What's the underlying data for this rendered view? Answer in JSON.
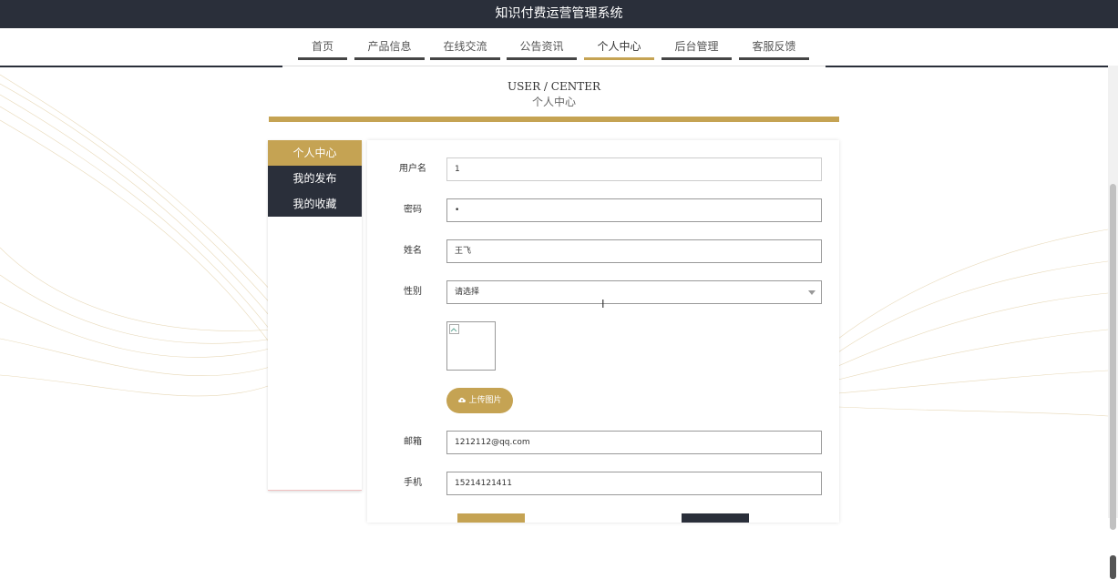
{
  "app": {
    "title": "知识付费运营管理系统"
  },
  "nav": {
    "items": [
      {
        "label": "首页"
      },
      {
        "label": "产品信息"
      },
      {
        "label": "在线交流"
      },
      {
        "label": "公告资讯"
      },
      {
        "label": "个人中心"
      },
      {
        "label": "后台管理"
      },
      {
        "label": "客服反馈"
      }
    ],
    "active": "个人中心"
  },
  "heading": {
    "en": "USER / CENTER",
    "cn": "个人中心"
  },
  "sidebar": {
    "items": [
      {
        "label": "个人中心"
      },
      {
        "label": "我的发布"
      },
      {
        "label": "我的收藏"
      }
    ]
  },
  "form": {
    "username": {
      "label": "用户名",
      "value": "1"
    },
    "password": {
      "label": "密码",
      "value": "•"
    },
    "name": {
      "label": "姓名",
      "value": "王飞"
    },
    "gender": {
      "label": "性别",
      "value": "请选择"
    },
    "upload": {
      "label": "上传图片"
    },
    "email": {
      "label": "邮箱",
      "value": "1212112@qq.com"
    },
    "phone": {
      "label": "手机",
      "value": "15214121411"
    }
  },
  "colors": {
    "accent": "#c5a353",
    "dark": "#2a2f3a"
  },
  "icons": {
    "upload": "cloud-upload-icon",
    "dropdown": "chevron-down-icon",
    "cursor": "text-cursor-icon"
  }
}
